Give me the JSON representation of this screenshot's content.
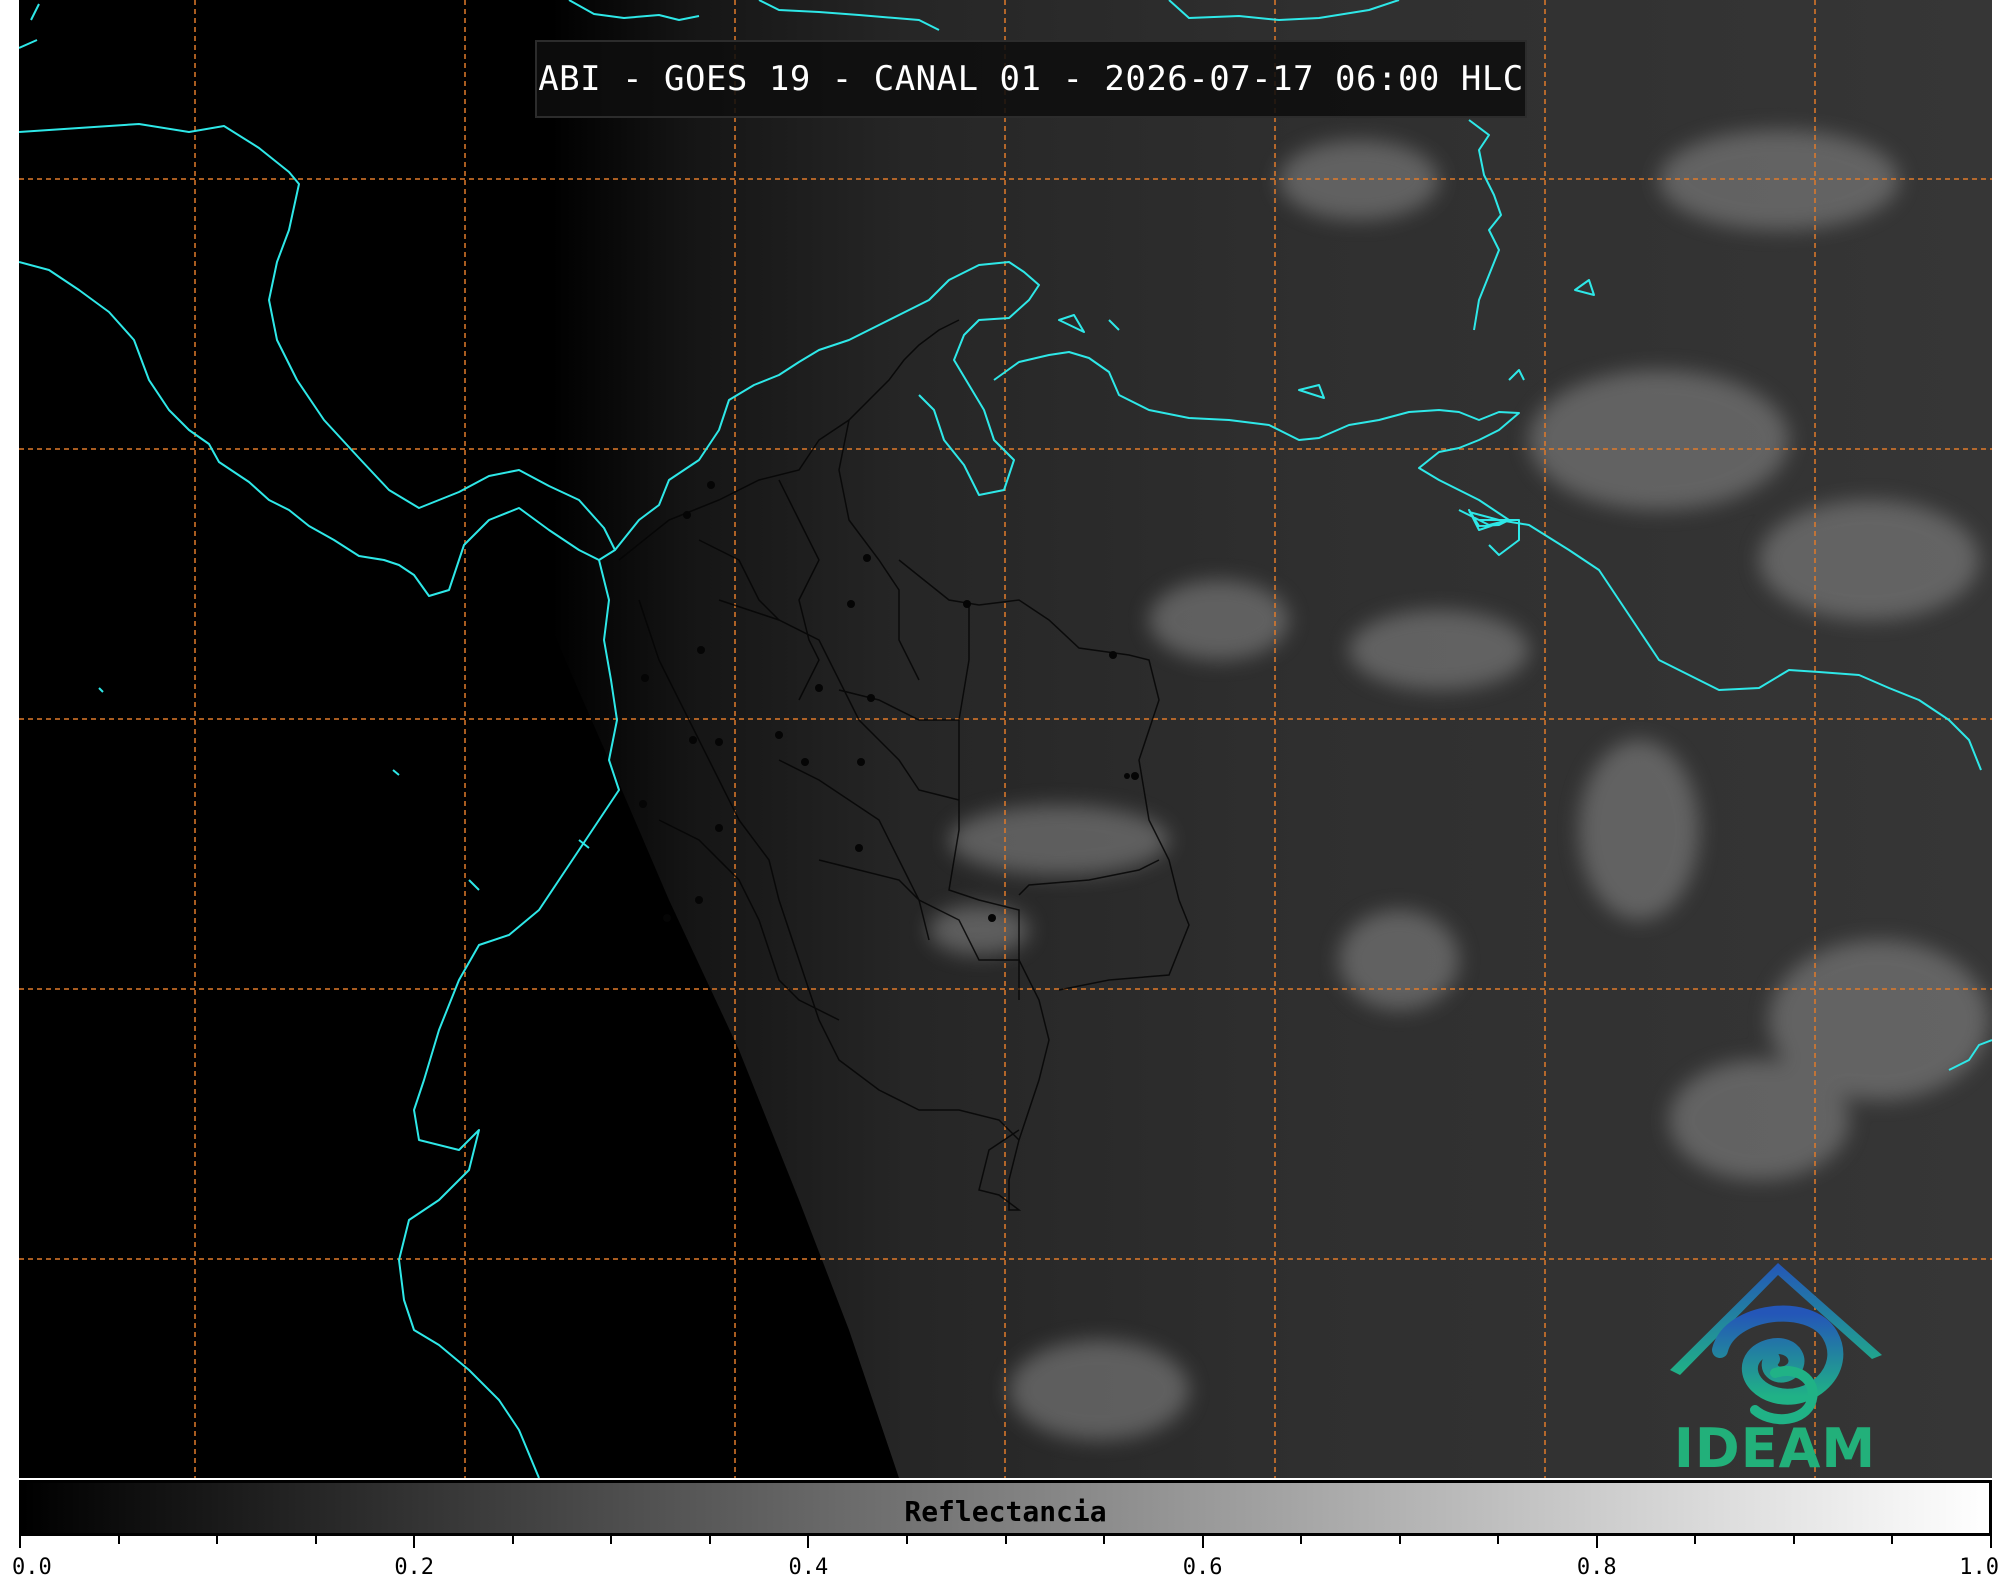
{
  "title": "ABI - GOES 19 - CANAL 01 - 2026-07-17 06:00 HLC",
  "logo": {
    "name": "ideam-logo",
    "text": "IDEAM"
  },
  "colorbar": {
    "label": "Reflectancia",
    "range": [
      0.0,
      1.0
    ],
    "ticks": [
      "0.0",
      "0.2",
      "0.4",
      "0.6",
      "0.8",
      "1.0"
    ],
    "colors": [
      "#000000",
      "#ffffff"
    ]
  },
  "map_style": {
    "coastline_color": "#2ee8e8",
    "border_color": "#000000",
    "grid_color": "#e07a2a",
    "grid_style": "dashed"
  }
}
